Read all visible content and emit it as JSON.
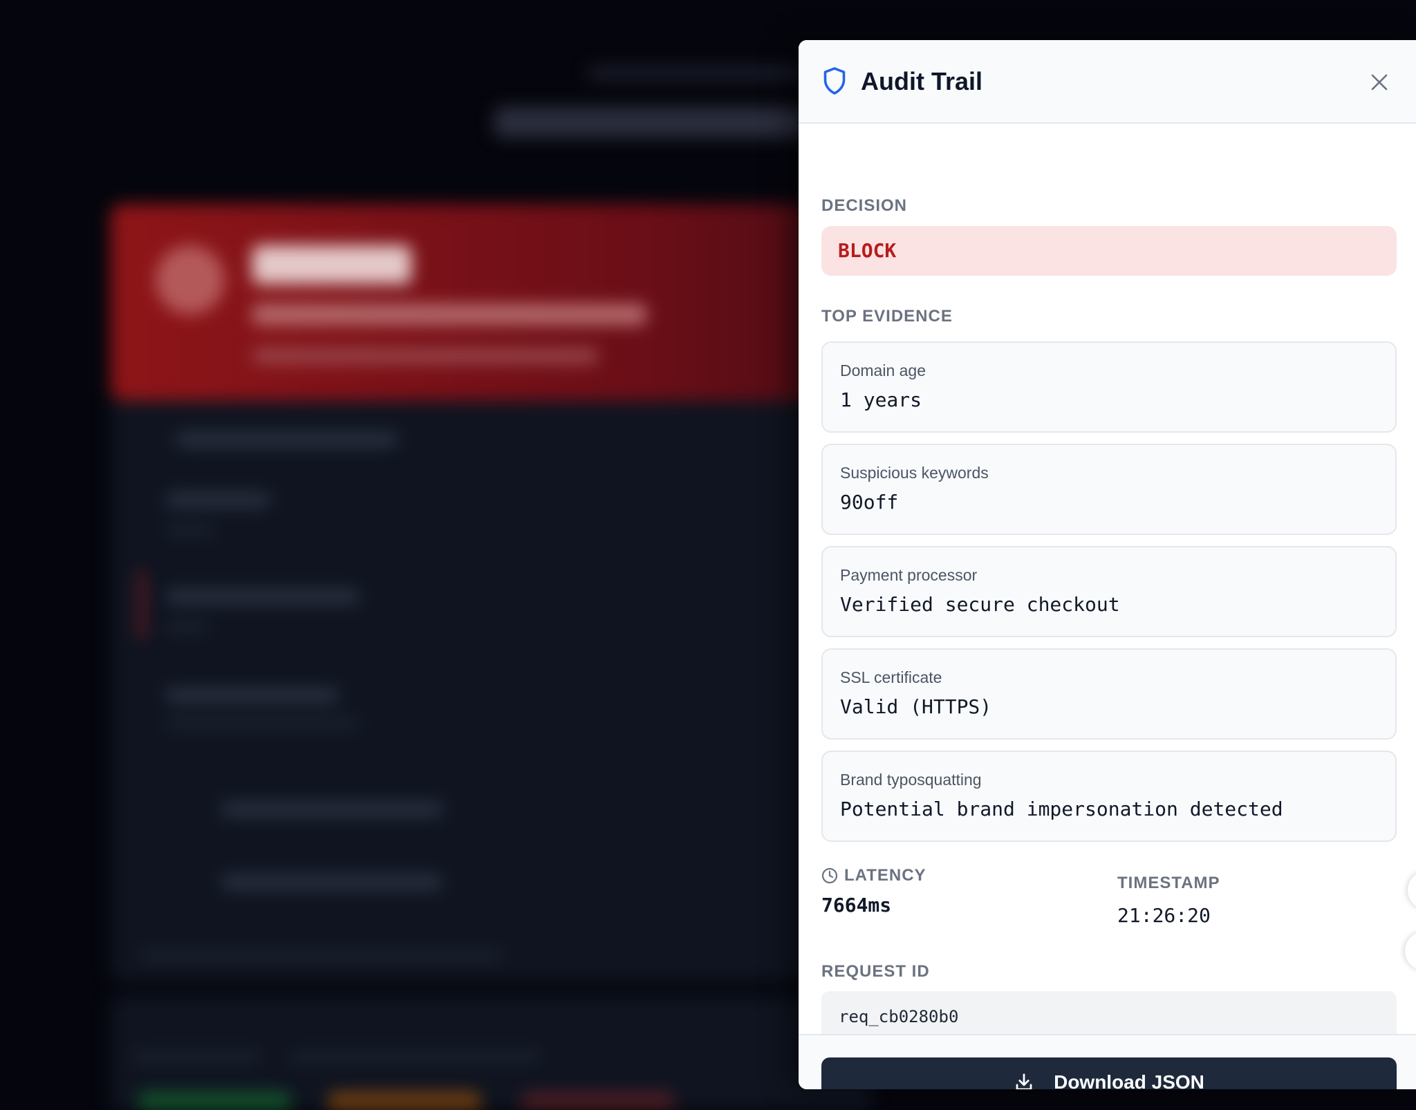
{
  "drawer": {
    "title": "Audit Trail",
    "close_icon": "close-icon",
    "header_icon": "shield-icon"
  },
  "decision": {
    "label": "DECISION",
    "value": "BLOCK",
    "color": "#b91c1c",
    "background": "#fbe3e3"
  },
  "evidence": {
    "label": "TOP EVIDENCE",
    "items": [
      {
        "label": "Domain age",
        "value": "1 years"
      },
      {
        "label": "Suspicious keywords",
        "value": "90off"
      },
      {
        "label": "Payment processor",
        "value": "Verified secure checkout"
      },
      {
        "label": "SSL certificate",
        "value": "Valid (HTTPS)"
      },
      {
        "label": "Brand typosquatting",
        "value": "Potential brand impersonation detected"
      }
    ]
  },
  "latency": {
    "label": "LATENCY",
    "value": "7664ms",
    "icon": "clock-icon"
  },
  "timestamp": {
    "label": "TIMESTAMP",
    "value": "21:26:20"
  },
  "request": {
    "label": "REQUEST ID",
    "value": "req_cb0280b0"
  },
  "footer": {
    "download_label": "Download JSON",
    "download_icon": "download-icon",
    "button_color": "#1e293b"
  },
  "background": {
    "accent": "#8e1518"
  }
}
